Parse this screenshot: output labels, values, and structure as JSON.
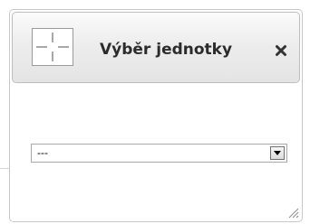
{
  "dialog": {
    "title": "Výběr jednotky",
    "icon": "crosshair-icon",
    "close_icon": "close-icon"
  },
  "unit_select": {
    "selected_value": "---",
    "arrow_icon": "chevron-down-icon"
  },
  "resize_grip_icon": "resize-grip-icon",
  "colors": {
    "titlebar_top": "#fbfbfb",
    "titlebar_bottom": "#e4e4e4",
    "border": "#c9c9c9",
    "text": "#2b2b2b"
  }
}
